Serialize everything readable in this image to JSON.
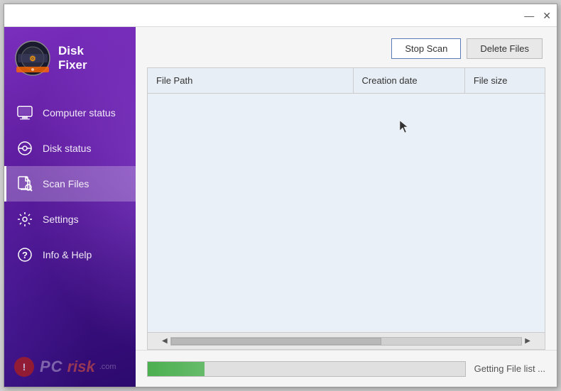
{
  "window": {
    "title": "Disk Fixer"
  },
  "titlebar": {
    "minimize_icon": "—",
    "close_icon": "✕"
  },
  "sidebar": {
    "logo_text_line1": "Disk",
    "logo_text_line2": "Fixer",
    "nav_items": [
      {
        "id": "computer-status",
        "label": "Computer status",
        "active": false
      },
      {
        "id": "disk-status",
        "label": "Disk status",
        "active": false
      },
      {
        "id": "scan-files",
        "label": "Scan Files",
        "active": true
      },
      {
        "id": "settings",
        "label": "Settings",
        "active": false
      },
      {
        "id": "info-help",
        "label": "Info & Help",
        "active": false
      }
    ]
  },
  "toolbar": {
    "stop_scan_label": "Stop Scan",
    "delete_files_label": "Delete Files"
  },
  "table": {
    "columns": [
      {
        "id": "filepath",
        "label": "File Path"
      },
      {
        "id": "creation_date",
        "label": "Creation date"
      },
      {
        "id": "file_size",
        "label": "File size"
      }
    ],
    "rows": []
  },
  "progress": {
    "status_text": "Getting File list ...",
    "fill_percent": 18
  }
}
